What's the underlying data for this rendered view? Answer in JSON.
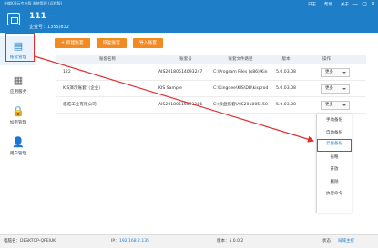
{
  "window": {
    "app_title": "金蝶K/3云专业版 系统管理 (远程版)",
    "links": [
      "日志",
      "帮助",
      "关于"
    ],
    "controls": [
      "—",
      "▢",
      "✕"
    ]
  },
  "account": {
    "name": "111",
    "name_tag": "·····",
    "id_label": "企业号：1355/832"
  },
  "sidebar": {
    "items": [
      {
        "label": "账套管理",
        "icon": "document-icon",
        "glyph": "▤"
      },
      {
        "label": "应用服务",
        "icon": "grid-icon",
        "glyph": "▦"
      },
      {
        "label": "加密管理",
        "icon": "lock-icon",
        "glyph": "🔒"
      },
      {
        "label": "用户管理",
        "icon": "user-icon",
        "glyph": "👤"
      }
    ]
  },
  "toolbar": {
    "new_label": "+ 新建账套",
    "restore_label": "恢复账套",
    "upgrade_label": "导入账套"
  },
  "table": {
    "headers": [
      "账套名称",
      "账套号",
      "账套文件路径",
      "版本",
      "操作"
    ],
    "rows": [
      {
        "name": "122",
        "code": "AIS20180514093247",
        "path": "C:\\Program Files (x86)\\Kingdee\\KIS\\...",
        "version": "5.0.03.08",
        "action": "更多"
      },
      {
        "name": "KIS演示账套（企业）",
        "code": "KIS Sample",
        "path": "C:\\Kingdee\\KIS\\DB\\kisprodemo",
        "version": "5.0.03.08",
        "action": "更多"
      },
      {
        "name": "骆驼工业有限公司",
        "code": "AIS20180515091106",
        "path": "C:\\云盘账套\\AIS20180515091106",
        "version": "5.0.03.08",
        "action": "更多"
      }
    ]
  },
  "dropdown": {
    "items": [
      "手动备份",
      "自动备份",
      "云盘备份",
      "省略",
      "开放",
      "删除",
      "执行命令"
    ]
  },
  "statusbar": {
    "pc_label": "电脑名：DESKTOP-QPEIUK",
    "ip_label": "IP：",
    "ip_value": "192.168.2.135",
    "version_label": "版本：5.0.0.2",
    "right_label": "状态：",
    "right_value": "局域主控"
  }
}
